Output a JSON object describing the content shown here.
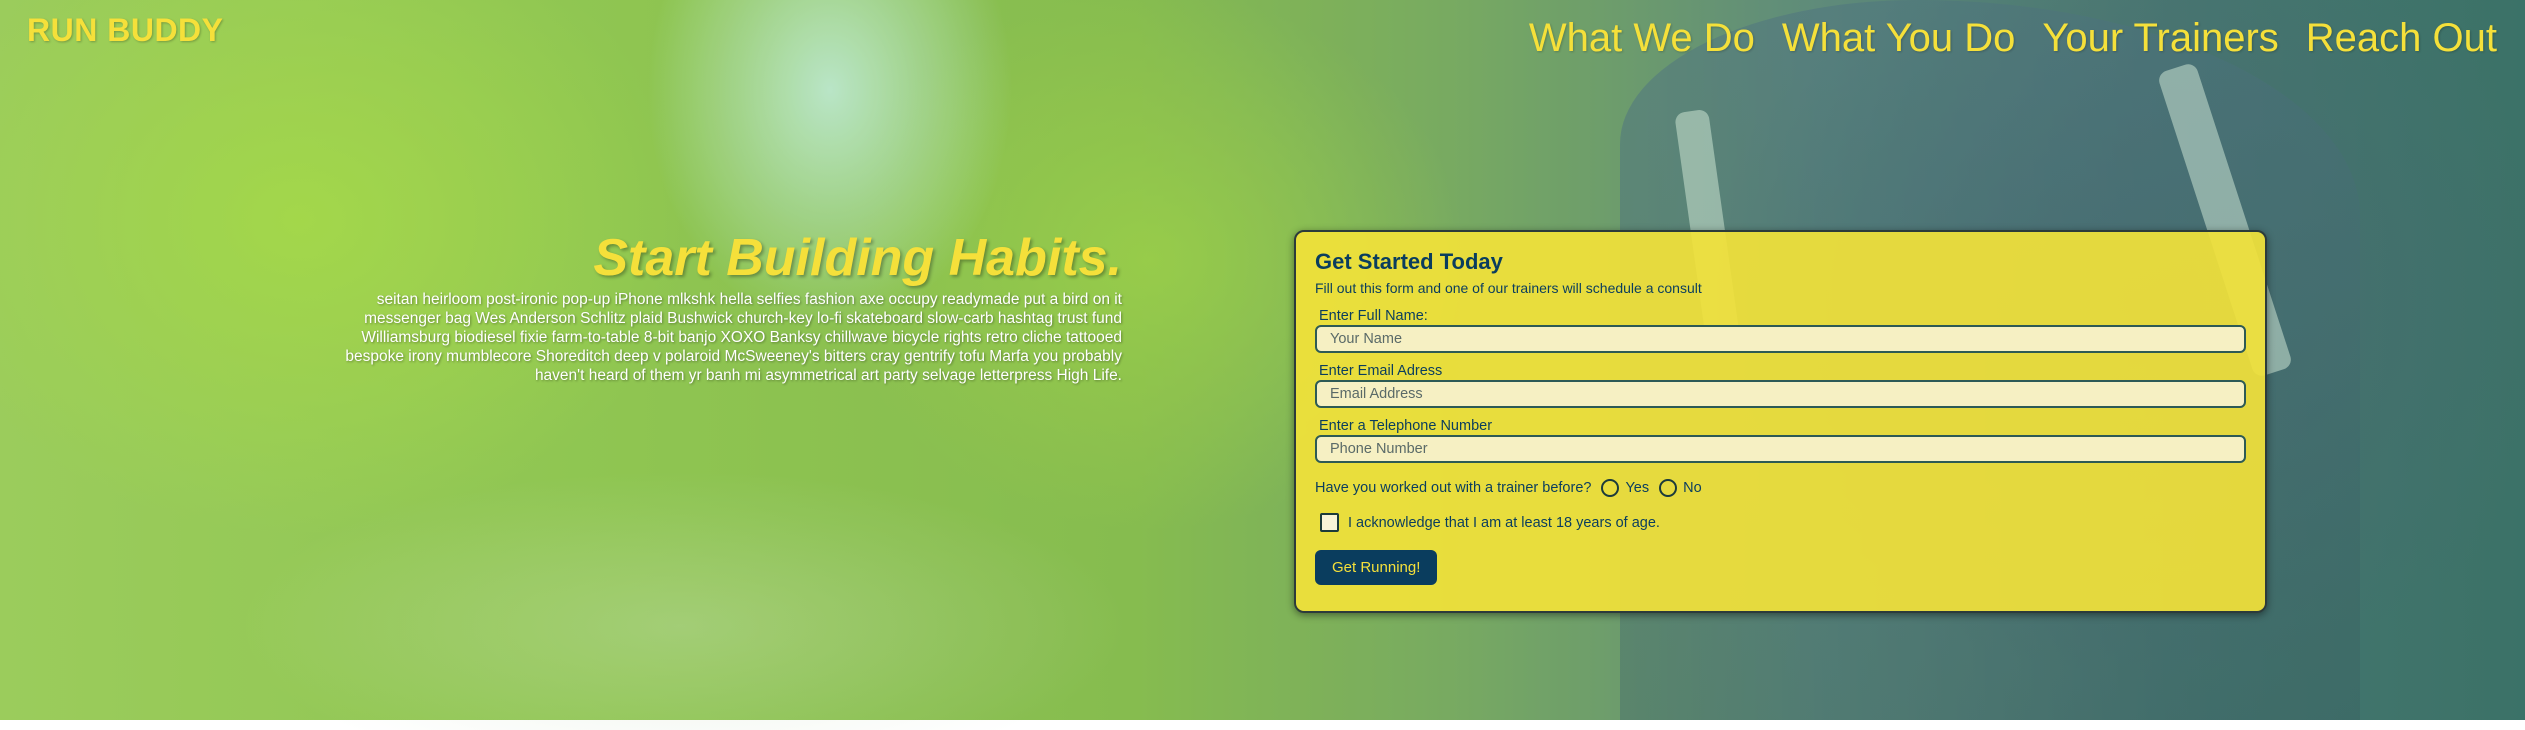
{
  "header": {
    "logo": "RUN BUDDY",
    "nav": [
      "What We Do",
      "What You Do",
      "Your Trainers",
      "Reach Out"
    ]
  },
  "hero": {
    "title": "Start Building Habits.",
    "body": "seitan heirloom post-ironic pop-up iPhone mlkshk hella selfies fashion axe occupy readymade put a bird on it messenger bag Wes Anderson Schlitz plaid Bushwick church-key lo-fi skateboard slow-carb hashtag trust fund Williamsburg biodiesel fixie farm-to-table 8-bit banjo XOXO Banksy chillwave bicycle rights retro cliche tattooed bespoke irony mumblecore Shoreditch deep v polaroid McSweeney's bitters cray gentrify tofu Marfa you probably haven't heard of them yr banh mi asymmetrical art party selvage letterpress High Life."
  },
  "form": {
    "title": "Get Started Today",
    "subtitle": "Fill out this form and one of our trainers will schedule a consult",
    "fields": [
      {
        "label": "Enter Full Name:",
        "placeholder": "Your Name"
      },
      {
        "label": "Enter Email Adress",
        "placeholder": "Email Address"
      },
      {
        "label": "Enter a Telephone Number",
        "placeholder": "Phone Number"
      }
    ],
    "question": "Have you worked out with a trainer before?",
    "options": [
      "Yes",
      "No"
    ],
    "acknowledge": "I acknowledge that I am at least 18 years of age.",
    "submit": "Get Running!"
  },
  "colors": {
    "brand_yellow": "#f5e03a",
    "navy": "#0a3d5e",
    "form_bg": "#f2e23a"
  }
}
